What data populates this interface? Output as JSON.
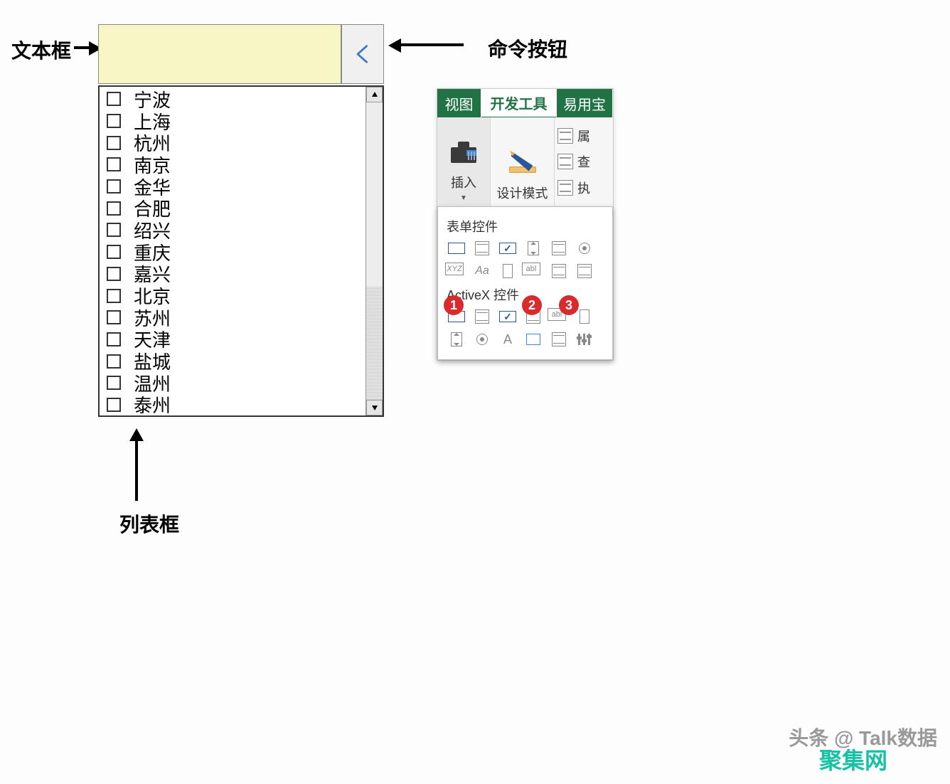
{
  "annotations": {
    "textbox_label": "文本框",
    "cmdbtn_label": "命令按钮",
    "listbox_label": "列表框"
  },
  "textbox": {
    "value": ""
  },
  "cmdbtn": {
    "symbol": "<"
  },
  "listbox": {
    "items": [
      "宁波",
      "上海",
      "杭州",
      "南京",
      "金华",
      "合肥",
      "绍兴",
      "重庆",
      "嘉兴",
      "北京",
      "苏州",
      "天津",
      "盐城",
      "温州",
      "泰州"
    ]
  },
  "ribbon": {
    "tabs": [
      "视图",
      "开发工具",
      "易用宝"
    ],
    "active_tab_index": 1,
    "insert_label": "插入",
    "design_label": "设计模式",
    "side": [
      "属",
      "查",
      "执"
    ],
    "panel": {
      "form_section": "表单控件",
      "activex_section": "ActiveX 控件",
      "xyz": "XYZ",
      "aa": "Aa",
      "abl": "abl",
      "letterA": "A",
      "badges": [
        "1",
        "2",
        "3"
      ]
    }
  },
  "watermarks": {
    "line1": "头条 @ Talk数据",
    "line2": "聚集网"
  }
}
